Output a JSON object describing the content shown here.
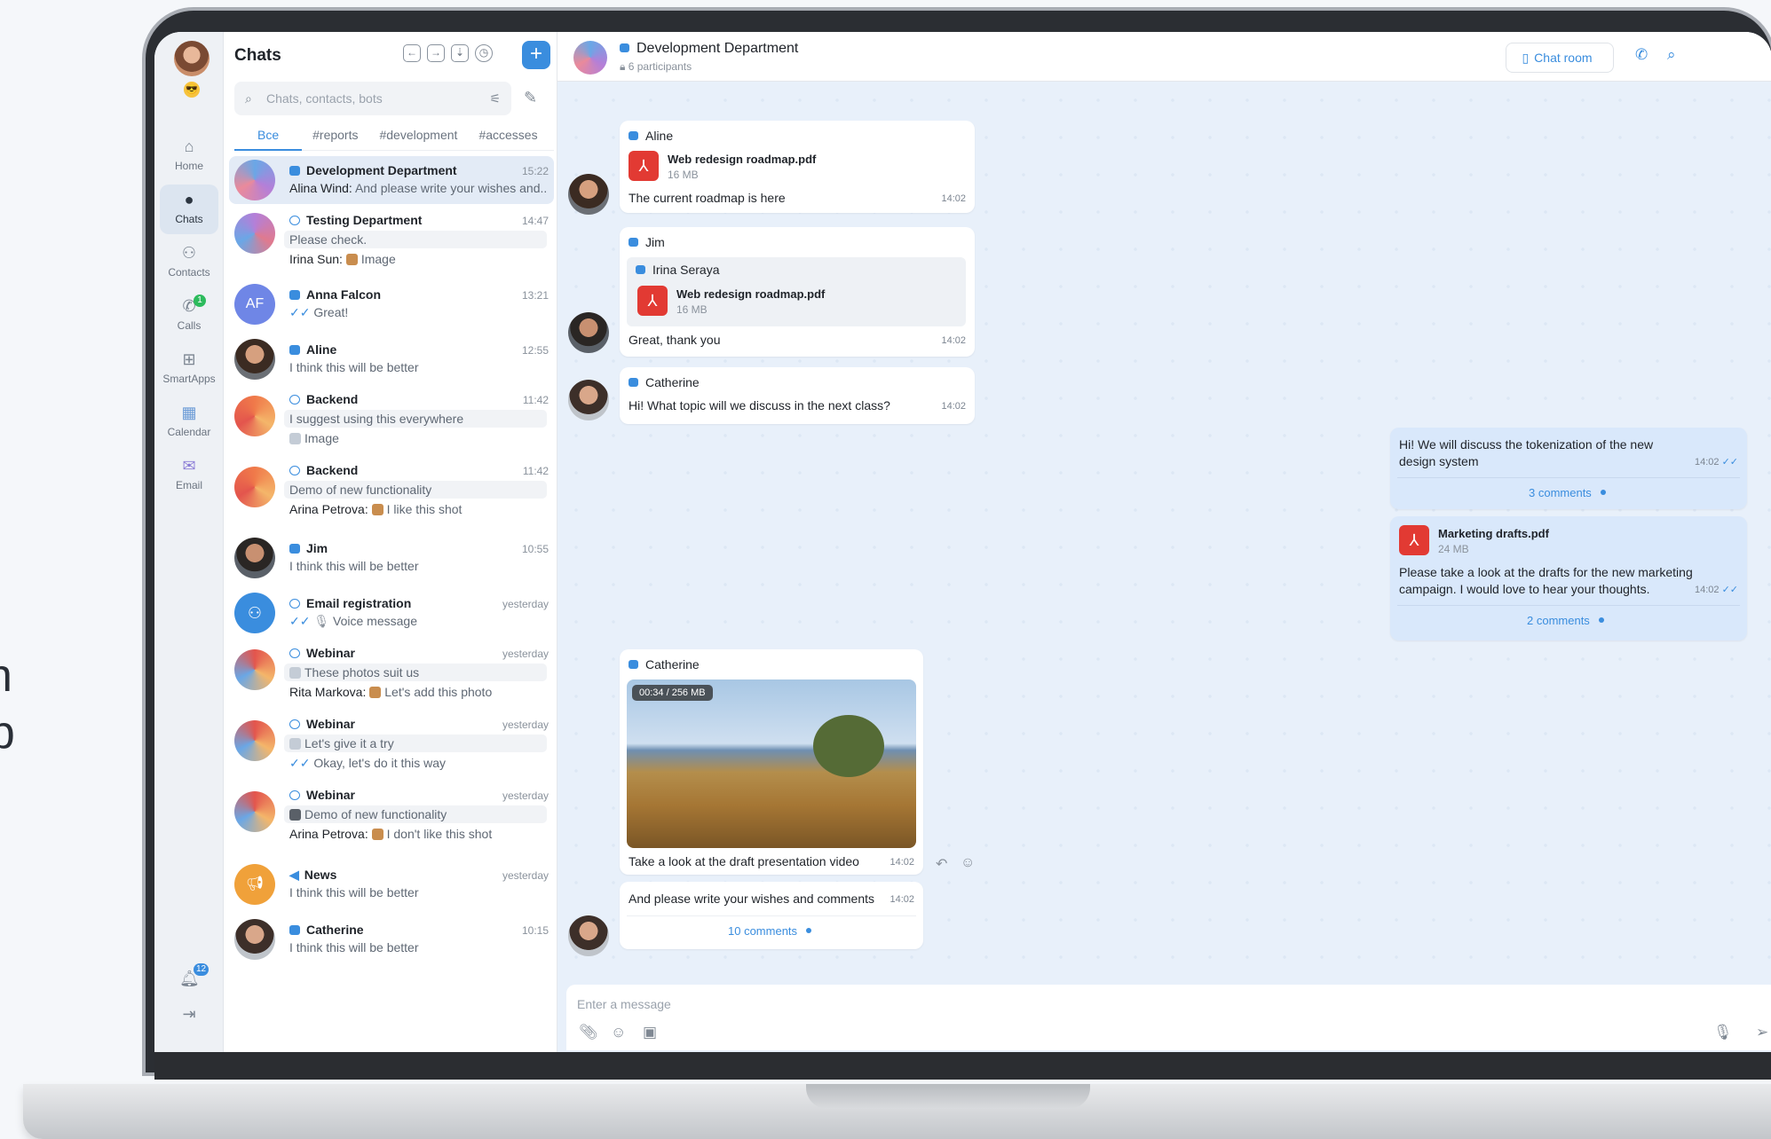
{
  "hero": {
    "line1": "vn",
    "line2": "op"
  },
  "rail": {
    "items": [
      {
        "label": "Home",
        "icon": "home-icon"
      },
      {
        "label": "Chats",
        "icon": "chat-bubble-icon"
      },
      {
        "label": "Contacts",
        "icon": "contacts-icon"
      },
      {
        "label": "Calls",
        "icon": "phone-icon",
        "badge": "1"
      },
      {
        "label": "SmartApps",
        "icon": "apps-grid-icon"
      },
      {
        "label": "Calendar",
        "icon": "calendar-icon"
      },
      {
        "label": "Email",
        "icon": "email-icon"
      }
    ],
    "bell_badge": "12"
  },
  "list": {
    "title": "Chats",
    "search_placeholder": "Chats, contacts, bots",
    "tabs": [
      "Все",
      "#reports",
      "#development",
      "#accesses"
    ],
    "chats": [
      {
        "name": "Development Department",
        "time": "15:22",
        "line1_author": "Alina Wind:",
        "line1": "And please write your wishes and..."
      },
      {
        "name": "Testing Department",
        "time": "14:47",
        "line1": "Please check.",
        "line2_author": "Irina Sun:",
        "line2": "Image"
      },
      {
        "name": "Anna Falcon",
        "time": "13:21",
        "line1": "Great!",
        "initials": "AF"
      },
      {
        "name": "Aline",
        "time": "12:55",
        "line1": "I think this will be better"
      },
      {
        "name": "Backend",
        "time": "11:42",
        "line1": "I suggest using this everywhere",
        "line2": "Image"
      },
      {
        "name": "Backend",
        "time": "11:42",
        "line1": "Demo of new functionality",
        "line2_author": "Arina Petrova:",
        "line2": "I like this shot"
      },
      {
        "name": "Jim",
        "time": "10:55",
        "line1": "I think this will be better"
      },
      {
        "name": "Email registration",
        "time": "yesterday",
        "line1": "Voice message"
      },
      {
        "name": "Webinar",
        "time": "yesterday",
        "line1": "These photos suit us",
        "line2_author": "Rita Markova:",
        "line2": "Let's add this photo"
      },
      {
        "name": "Webinar",
        "time": "yesterday",
        "line1": "Let's give it a try",
        "line2": "Okay, let's do it this way"
      },
      {
        "name": "Webinar",
        "time": "yesterday",
        "line1": "Demo of new functionality",
        "line2_author": "Arina Petrova:",
        "line2": "I don't like this shot"
      },
      {
        "name": "News",
        "time": "yesterday",
        "line1": "I think this will be better"
      },
      {
        "name": "Catherine",
        "time": "10:15",
        "line1": "I think this will be better"
      }
    ]
  },
  "header": {
    "title": "Development Department",
    "subtitle": "6 participants",
    "room_button": "Chat room"
  },
  "messages": {
    "m1": {
      "sender": "Aline",
      "file": "Web redesign roadmap.pdf",
      "size": "16 MB",
      "text": "The current roadmap is here",
      "time": "14:02"
    },
    "m2": {
      "sender": "Jim",
      "quote_sender": "Irina Seraya",
      "file": "Web redesign roadmap.pdf",
      "size": "16 MB",
      "text": "Great, thank you",
      "time": "14:02"
    },
    "m3": {
      "sender": "Catherine",
      "text": "Hi! What topic will we discuss in the next class?",
      "time": "14:02"
    },
    "o1": {
      "text": "Hi! We will discuss the tokenization of the new design system",
      "time": "14:02",
      "comments": "3 comments"
    },
    "o2": {
      "file": "Marketing drafts.pdf",
      "size": "24 MB",
      "text": "Please take a look at the drafts for the new marketing campaign. I would love to hear your thoughts.",
      "time": "14:02",
      "comments": "2 comments"
    },
    "m4": {
      "sender": "Catherine",
      "video_badge": "00:34 / 256 MB",
      "text": "Take a look at the draft presentation video",
      "time": "14:02"
    },
    "m5": {
      "text": "And please write your wishes and comments",
      "time": "14:02",
      "comments": "10 comments"
    }
  },
  "input": {
    "placeholder": "Enter a message"
  }
}
